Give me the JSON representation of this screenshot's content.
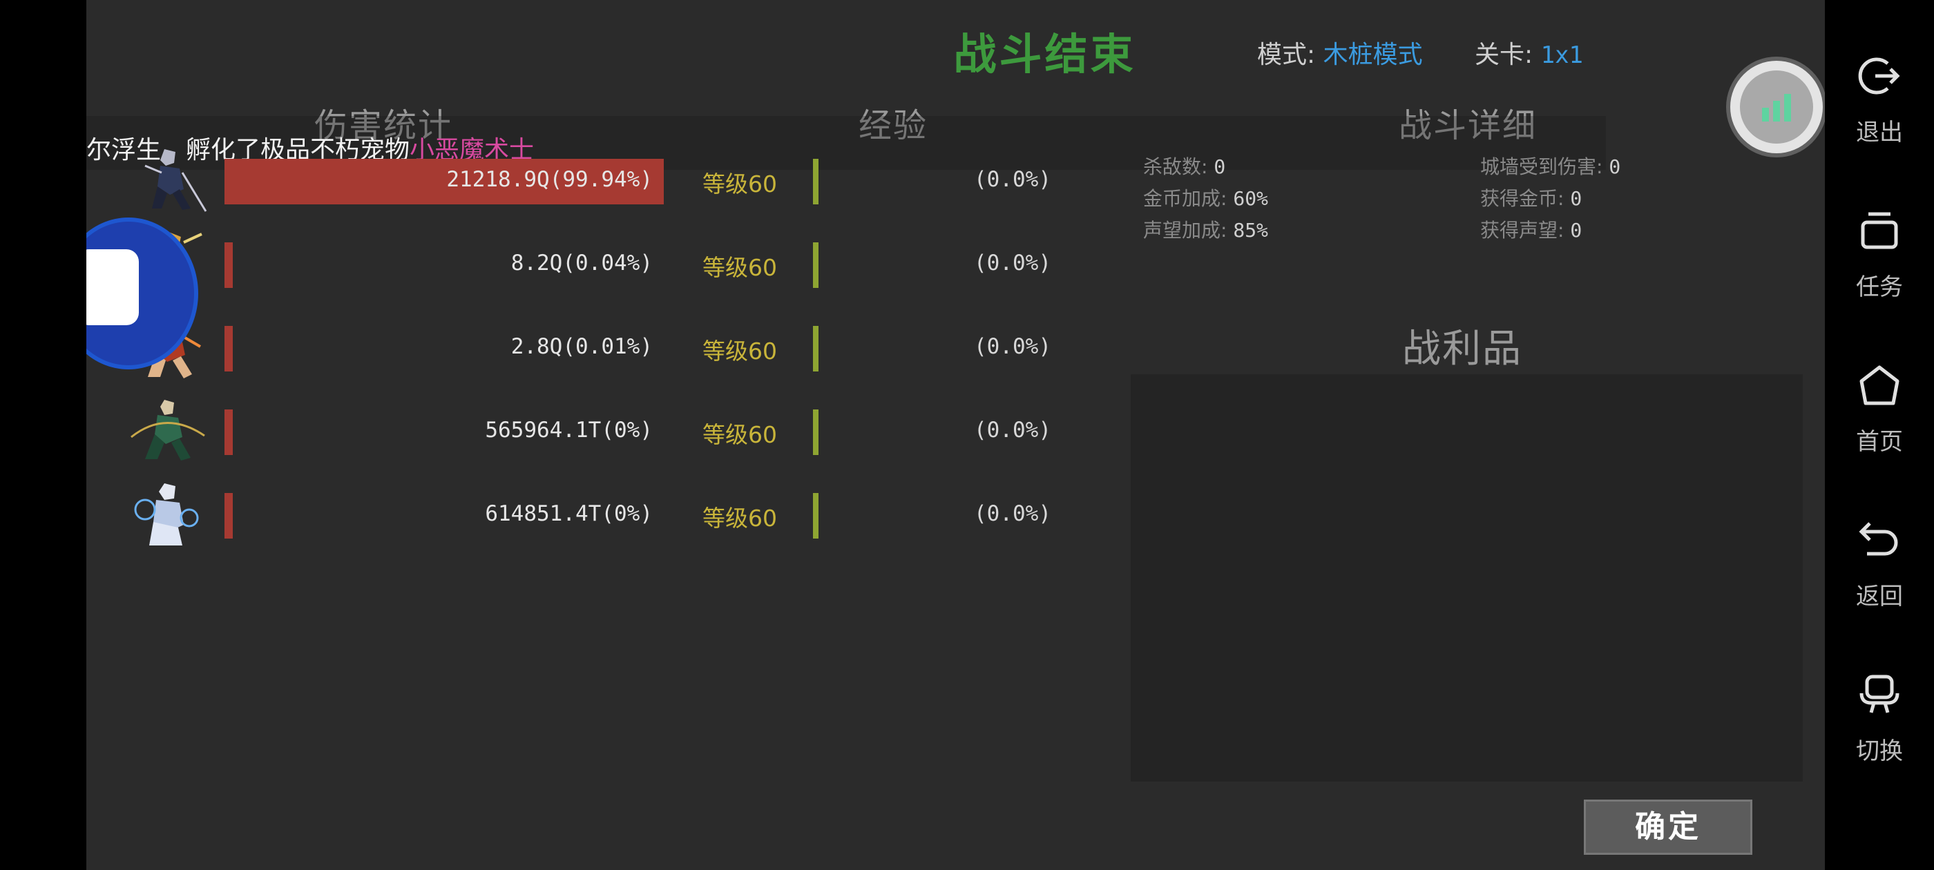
{
  "header": {
    "title": "战斗结束",
    "mode_label": "模式:",
    "mode_value": "木桩模式",
    "stage_label": "关卡:",
    "stage_value": "1x1"
  },
  "sections": {
    "damage": "伤害统计",
    "exp": "经验",
    "detail": "战斗详细",
    "loot": "战利品"
  },
  "ticker": {
    "text": "尔浮生，孵化了极品不朽宠物",
    "pet": "小恶魔术士"
  },
  "heroes": [
    {
      "damage": "21218.9Q(99.94%)",
      "share": 99.94,
      "level": "等级60",
      "exp": "(0.0%)",
      "portrait": "swordsman-portrait"
    },
    {
      "damage": "8.2Q(0.04%)",
      "share": 0.04,
      "level": "等级60",
      "exp": "(0.0%)",
      "portrait": "golden-warrior-portrait"
    },
    {
      "damage": "2.8Q(0.01%)",
      "share": 0.01,
      "level": "等级60",
      "exp": "(0.0%)",
      "portrait": "fire-warrior-portrait"
    },
    {
      "damage": "565964.1T(0%)",
      "share": 0,
      "level": "等级60",
      "exp": "(0.0%)",
      "portrait": "archer-portrait"
    },
    {
      "damage": "614851.4T(0%)",
      "share": 0,
      "level": "等级60",
      "exp": "(0.0%)",
      "portrait": "ice-mage-portrait"
    }
  ],
  "detail": {
    "kills_label": "杀敌数:",
    "kills_value": "0",
    "wall_label": "城墙受到伤害:",
    "wall_value": "0",
    "gold_bonus_label": "金币加成:",
    "gold_bonus_value": "60%",
    "gold_gain_label": "获得金币:",
    "gold_gain_value": "0",
    "fame_bonus_label": "声望加成:",
    "fame_bonus_value": "85%",
    "fame_gain_label": "获得声望:",
    "fame_gain_value": "0"
  },
  "buttons": {
    "confirm": "确定"
  },
  "system_nav": [
    {
      "label": "退出",
      "icon": "exit-icon"
    },
    {
      "label": "任务",
      "icon": "tasks-icon"
    },
    {
      "label": "首页",
      "icon": "home-icon"
    },
    {
      "label": "返回",
      "icon": "back-icon"
    },
    {
      "label": "切换",
      "icon": "switch-icon"
    }
  ],
  "colors": {
    "title": "#3d9a3d",
    "accent_blue": "#3b9be0",
    "damage_bar": "#a63a32",
    "level_text": "#c9b53a",
    "exp_bar": "#8ea532",
    "pet_name": "#d84aa0"
  }
}
